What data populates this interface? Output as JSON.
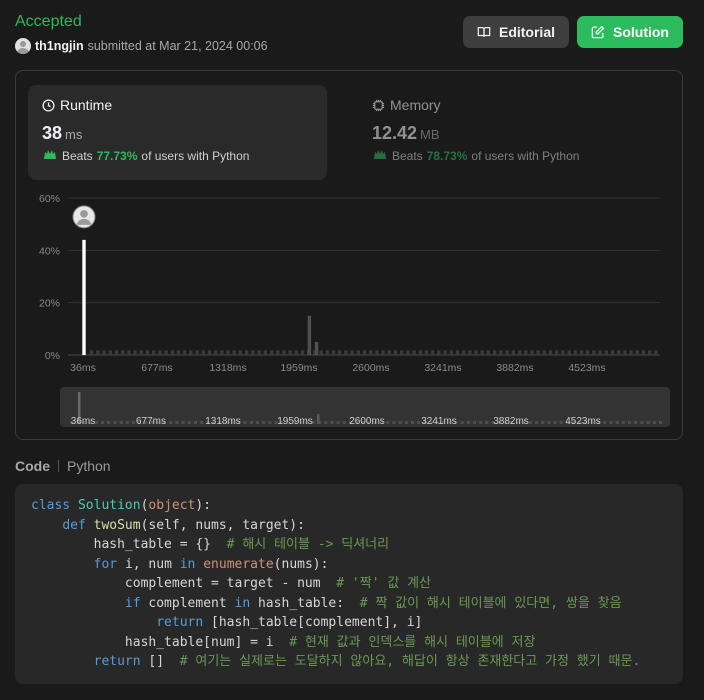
{
  "header": {
    "status": "Accepted",
    "username": "th1ngjin",
    "submitted_text": "submitted at Mar 21, 2024 00:06",
    "editorial_label": "Editorial",
    "solution_label": "Solution",
    "colors": {
      "accepted": "#2cbb5d",
      "solution_button": "#2cbb5d",
      "editorial_button": "#3e3e3e"
    }
  },
  "runtime": {
    "title": "Runtime",
    "value": "38",
    "unit": "ms",
    "beats_prefix": "Beats",
    "beats_pct": "77.73%",
    "beats_suffix": "of users with Python",
    "icon": "clock-icon"
  },
  "memory": {
    "title": "Memory",
    "value": "12.42",
    "unit": "MB",
    "beats_prefix": "Beats",
    "beats_pct": "78.73%",
    "beats_suffix": "of users with Python",
    "icon": "chip-icon"
  },
  "chart_data": {
    "type": "bar",
    "title": "",
    "xlabel": "",
    "ylabel": "",
    "y_ticks": [
      "60%",
      "40%",
      "20%",
      "0%"
    ],
    "ylim": [
      0,
      60
    ],
    "x_ticks": [
      "36ms",
      "677ms",
      "1318ms",
      "1959ms",
      "2600ms",
      "3241ms",
      "3882ms",
      "4523ms"
    ],
    "xlim": [
      36,
      4950
    ],
    "bars": [
      {
        "x": 36,
        "value": 44,
        "highlight": true
      },
      {
        "x": 1959,
        "value": 15
      },
      {
        "x": 2020,
        "value": 5
      }
    ],
    "baseline_value": 1.8,
    "grid": true
  },
  "code": {
    "tab_label": "Code",
    "language": "Python",
    "lines": [
      [
        {
          "t": "class ",
          "c": "kw"
        },
        {
          "t": "Solution",
          "c": "cls"
        },
        {
          "t": "(",
          "c": "tx"
        },
        {
          "t": "object",
          "c": "builtin"
        },
        {
          "t": "):",
          "c": "tx"
        }
      ],
      [
        {
          "t": "    ",
          "c": "tx"
        },
        {
          "t": "def ",
          "c": "kw"
        },
        {
          "t": "twoSum",
          "c": "fn"
        },
        {
          "t": "(self, nums, target):",
          "c": "tx"
        }
      ],
      [
        {
          "t": "        hash_table = {}  ",
          "c": "tx"
        },
        {
          "t": "# 해시 테이블 -> 딕셔너리",
          "c": "cm"
        }
      ],
      [
        {
          "t": "        ",
          "c": "tx"
        },
        {
          "t": "for ",
          "c": "kw"
        },
        {
          "t": "i, num ",
          "c": "tx"
        },
        {
          "t": "in ",
          "c": "kw"
        },
        {
          "t": "enumerate",
          "c": "builtin"
        },
        {
          "t": "(nums):",
          "c": "tx"
        }
      ],
      [
        {
          "t": "            complement = target - num  ",
          "c": "tx"
        },
        {
          "t": "# '짝' 값 계산",
          "c": "cm"
        }
      ],
      [
        {
          "t": "            ",
          "c": "tx"
        },
        {
          "t": "if ",
          "c": "kw"
        },
        {
          "t": "complement ",
          "c": "tx"
        },
        {
          "t": "in ",
          "c": "kw"
        },
        {
          "t": "hash_table:  ",
          "c": "tx"
        },
        {
          "t": "# 짝 값이 해시 테이블에 있다면, 쌍을 찾음",
          "c": "cm"
        }
      ],
      [
        {
          "t": "                ",
          "c": "tx"
        },
        {
          "t": "return ",
          "c": "kw"
        },
        {
          "t": "[hash_table[complement], i]",
          "c": "tx"
        }
      ],
      [
        {
          "t": "            hash_table[num] = i  ",
          "c": "tx"
        },
        {
          "t": "# 현재 값과 인덱스를 해시 테이블에 저장",
          "c": "cm"
        }
      ],
      [
        {
          "t": "        ",
          "c": "tx"
        },
        {
          "t": "return ",
          "c": "kw"
        },
        {
          "t": "[]  ",
          "c": "tx"
        },
        {
          "t": "# 여기는 실제로는 도달하지 않아요, 해답이 항상 존재한다고 가정 했기 때문.",
          "c": "cm"
        }
      ]
    ]
  }
}
